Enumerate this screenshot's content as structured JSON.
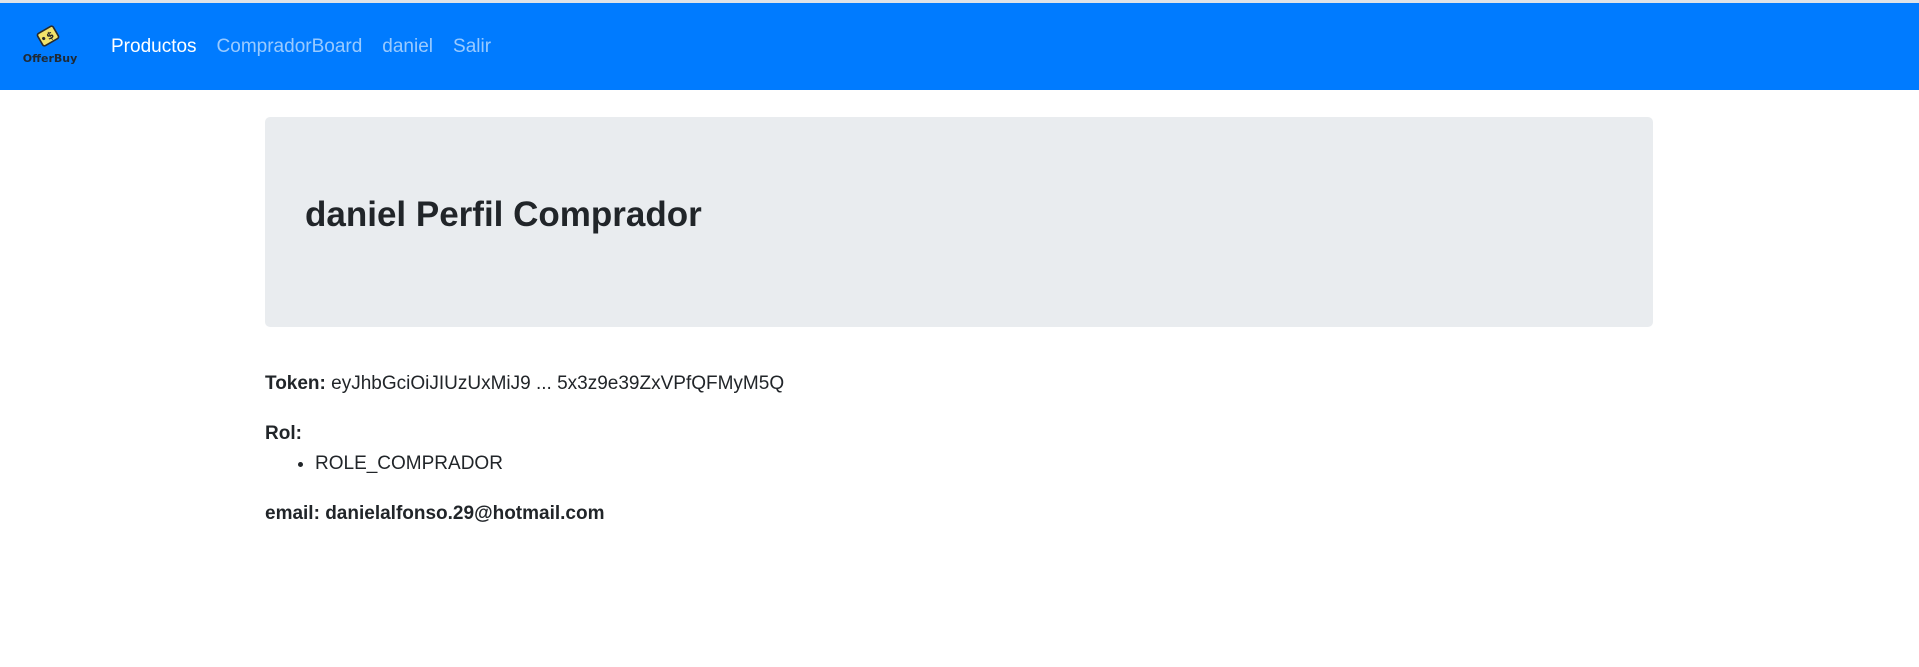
{
  "navbar": {
    "brand_logo_text": "OfferBuy",
    "links": [
      {
        "label": "Productos",
        "active": true
      },
      {
        "label": "CompradorBoard",
        "active": false
      },
      {
        "label": "daniel",
        "active": false
      },
      {
        "label": "Salir",
        "active": false
      }
    ],
    "background_color": "#007bff"
  },
  "profile": {
    "title": "daniel Perfil Comprador",
    "token_label": "Token:",
    "token_value": "eyJhbGciOiJIUzUxMiJ9 ... 5x3z9e39ZxVPfQFMyM5Q",
    "rol_label": "Rol:",
    "roles": [
      "ROLE_COMPRADOR"
    ],
    "email_text": "email: danielalfonso.29@hotmail.com"
  }
}
